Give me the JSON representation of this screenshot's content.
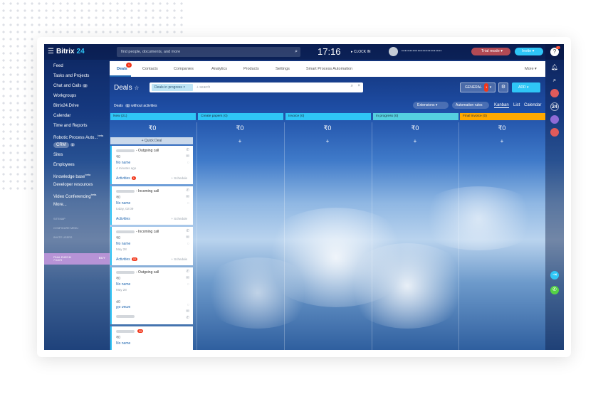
{
  "topbar": {
    "brand": "Bitrix",
    "brand_num": "24",
    "search_placeholder": "find people, documents, and more",
    "time": "17:16",
    "clock_in": "CLOCK IN",
    "trial_mode": "Trial mode",
    "invite": "Invite"
  },
  "sidebar": {
    "items": [
      "Feed",
      "Tasks and Projects",
      "Chat and Calls",
      "Workgroups",
      "Bitrix24.Drive",
      "Calendar",
      "Time and Reports",
      "Robotic Process Auto...",
      "CRM",
      "Sites",
      "Employees",
      "Knowledge base",
      "Developer resources",
      "Video Conferencing",
      "More..."
    ],
    "chat_badge": "2",
    "crm_badge": "1",
    "rpa_suffix": "beta",
    "kb_suffix": "beta",
    "vc_suffix": "beta",
    "sitemap": "SITEMAP",
    "configure_menu": "CONFIGURE MENU",
    "invite_users": "INVITE USERS",
    "plan_line1": "FINAL ENDS IN",
    "plan_line2": "7 DAYS",
    "buy": "BUY"
  },
  "tabs": {
    "items": [
      "Deals",
      "Contacts",
      "Companies",
      "Analytics",
      "Products",
      "Settings",
      "Smart Process Automation"
    ],
    "more": "More",
    "deals_badge": "1"
  },
  "toolbar": {
    "title": "Deals",
    "filter_chip": "Deals in progress",
    "filter_search": "+ search",
    "general": "GENERAL",
    "general_badge": "1",
    "add": "ADD"
  },
  "subbar": {
    "deals_label": "Deals",
    "deals_count": "1",
    "without_activities": "without activities",
    "extensions": "Extensions",
    "automation_rules": "Automation rules",
    "views": [
      "Kanban",
      "List",
      "Calendar"
    ]
  },
  "kanban": {
    "columns": [
      {
        "title": "New",
        "count": "(21)",
        "sum": "₹0",
        "color": "#2fc6f6"
      },
      {
        "title": "Create papers",
        "count": "(0)",
        "sum": "₹0",
        "color": "#2fc6f6"
      },
      {
        "title": "Invoice",
        "count": "(0)",
        "sum": "₹0",
        "color": "#2fc6f6"
      },
      {
        "title": "In progress",
        "count": "(0)",
        "sum": "₹0",
        "color": "#55d0e0"
      },
      {
        "title": "Final invoice",
        "count": "(0)",
        "sum": "₹0",
        "color": "#ffa900"
      }
    ],
    "plus": "+",
    "quick_deal": "+ Quick Deal",
    "cards": [
      {
        "title": "- Outgoing call",
        "amount": "₹0",
        "customer": "No name",
        "date": "4 minutes ago",
        "activities": "Activities",
        "act_badge": "1",
        "schedule": "+ Schedule"
      },
      {
        "title": "- Incoming call",
        "amount": "₹0",
        "customer": "No name",
        "date": "today, 02:09",
        "activities": "Activities",
        "schedule": "+ Schedule"
      },
      {
        "title": "- Incoming call",
        "amount": "₹0",
        "customer": "No name",
        "date": "May 28",
        "activities": "Activities",
        "act_badge": "22",
        "schedule": "+ Schedule"
      },
      {
        "title": "- Outgoing call",
        "amount": "₹0",
        "customer": "No name",
        "date": "May 28",
        "activities": "",
        "schedule": ""
      }
    ],
    "card4_extra_amount": "₹0",
    "card4_extra_customer": "No name",
    "card5_badge": "35",
    "card5_amount": "₹0",
    "card5_customer": "No name"
  },
  "right_strip": {
    "counter": "24",
    "help_badge": "17"
  }
}
